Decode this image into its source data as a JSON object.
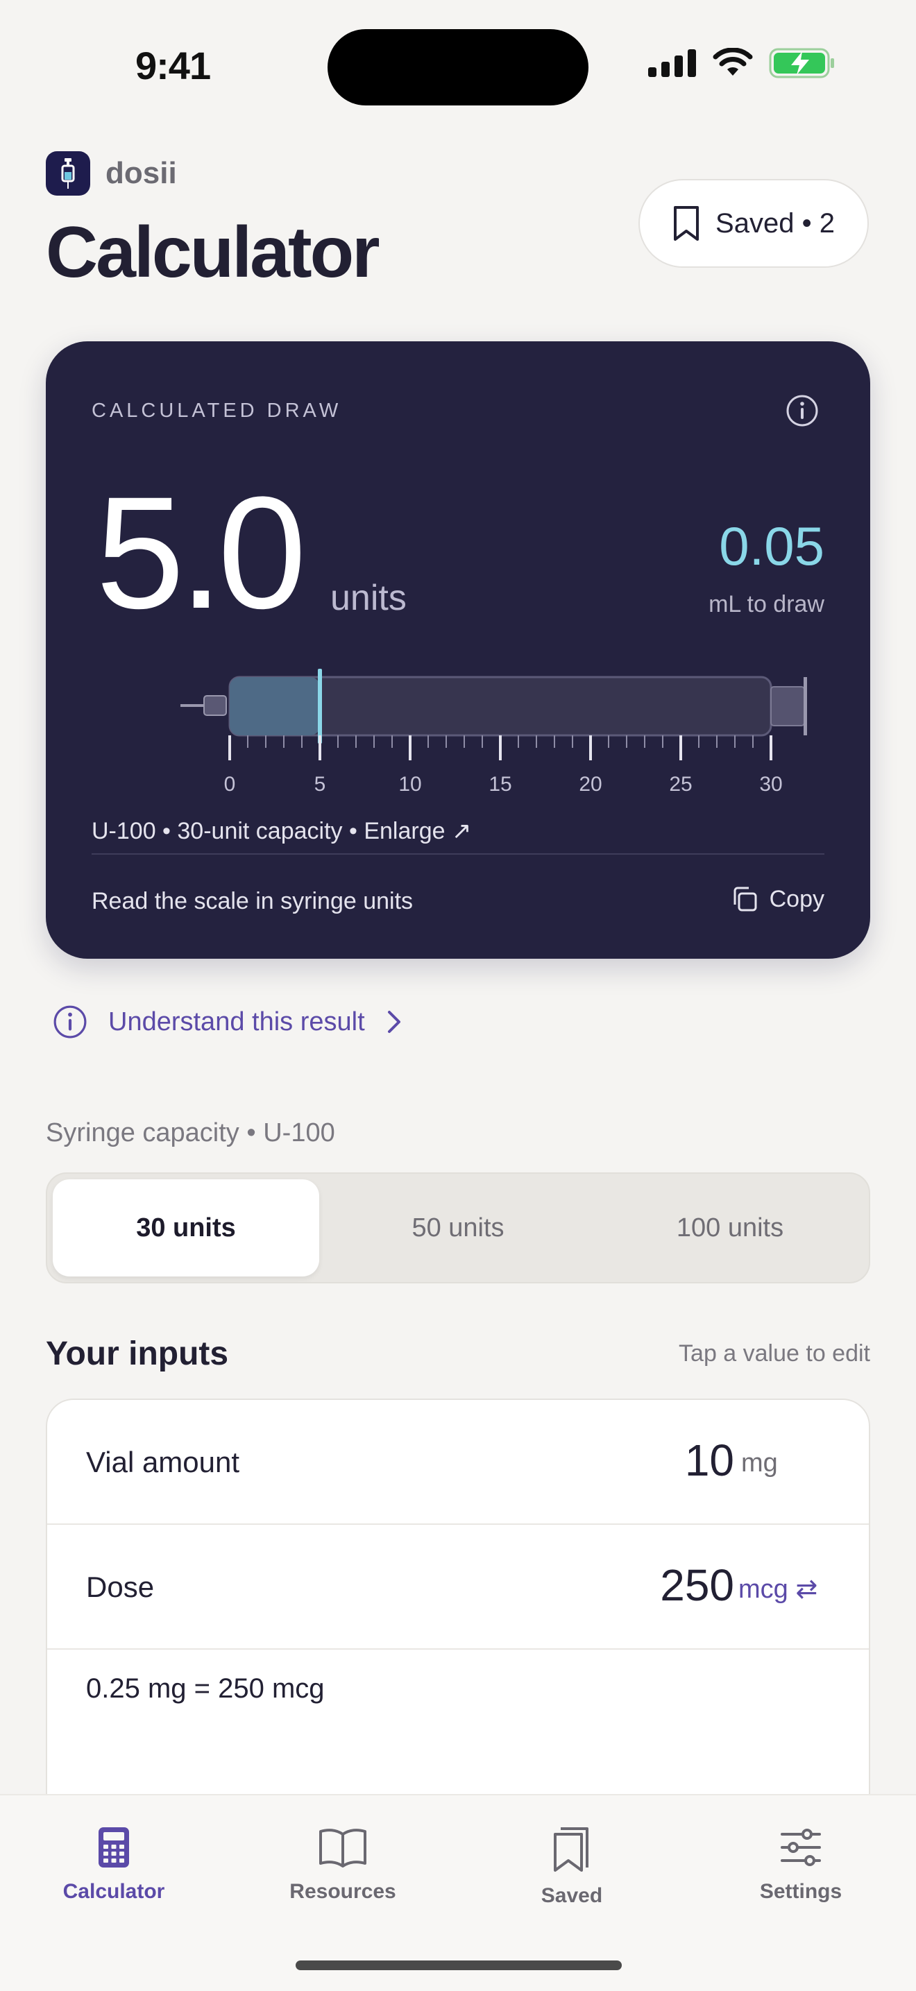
{
  "status": {
    "time": "9:41"
  },
  "header": {
    "app_name": "dosii",
    "title": "Calculator",
    "saved_label": "Saved • 2"
  },
  "result": {
    "label": "CALCULATED DRAW",
    "value": "5.0",
    "unit": "units",
    "ml_value": "0.05",
    "ml_label": "mL to draw",
    "fill_units": 5,
    "capacity_units": 30,
    "scale_ticks": [
      "0",
      "5",
      "10",
      "15",
      "20",
      "25",
      "30"
    ],
    "syringe_info": "U-100 • 30-unit capacity • Enlarge ↗",
    "footer_text": "Read the scale in syringe units",
    "copy_label": "Copy"
  },
  "understand_link": "Understand this result",
  "syringe_capacity": {
    "label": "Syringe capacity • U-100",
    "options": [
      "30 units",
      "50 units",
      "100 units"
    ],
    "selected": "30 units"
  },
  "inputs": {
    "title": "Your inputs",
    "hint": "Tap a value to edit",
    "rows": [
      {
        "label": "Vial amount",
        "value": "10",
        "unit": "mg"
      },
      {
        "label": "Dose",
        "value": "250",
        "unit": "mcg ⇄"
      }
    ],
    "conversion": "0.25 mg = 250 mcg"
  },
  "tabs": [
    {
      "label": "Calculator",
      "icon": "calculator-icon",
      "active": true
    },
    {
      "label": "Resources",
      "icon": "book-icon",
      "active": false
    },
    {
      "label": "Saved",
      "icon": "bookmarks-icon",
      "active": false
    },
    {
      "label": "Settings",
      "icon": "sliders-icon",
      "active": false
    }
  ],
  "colors": {
    "accent": "#5b4aa8",
    "card": "#24223f",
    "ml": "#8ad7e8"
  }
}
